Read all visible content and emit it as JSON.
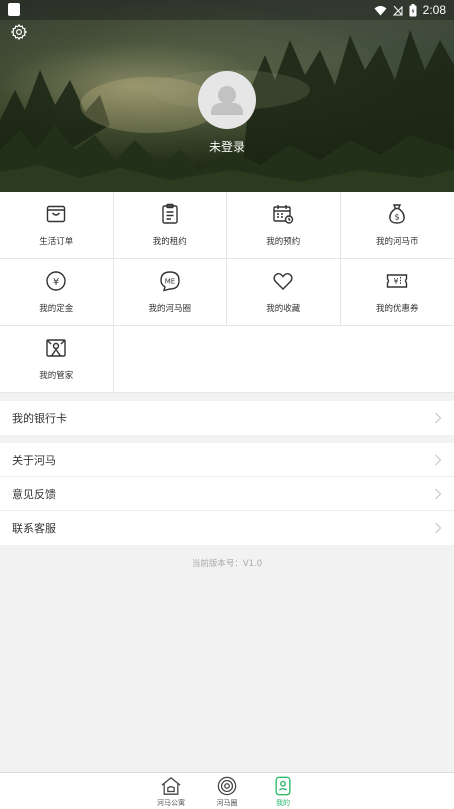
{
  "status_bar": {
    "time": "2:08"
  },
  "profile": {
    "login_text": "未登录"
  },
  "grid": [
    [
      {
        "label": "生活订单",
        "icon": "bag-icon"
      },
      {
        "label": "我的租约",
        "icon": "clipboard-icon"
      },
      {
        "label": "我的预约",
        "icon": "calendar-clock-icon"
      },
      {
        "label": "我的河马币",
        "icon": "money-bag-icon"
      }
    ],
    [
      {
        "label": "我的定金",
        "icon": "yen-coin-icon"
      },
      {
        "label": "我的河马圈",
        "icon": "me-chat-icon"
      },
      {
        "label": "我的收藏",
        "icon": "heart-icon"
      },
      {
        "label": "我的优惠券",
        "icon": "coupon-icon"
      }
    ],
    [
      {
        "label": "我的管家",
        "icon": "housekeeper-icon"
      }
    ]
  ],
  "bank_card": {
    "label": "我的银行卡"
  },
  "menu": [
    {
      "label": "关于河马"
    },
    {
      "label": "意见反馈"
    },
    {
      "label": "联系客服"
    }
  ],
  "version_text": "当前版本号：V1.0",
  "tabs": [
    {
      "label": "河马公寓",
      "icon": "house-icon",
      "active": false
    },
    {
      "label": "河马圈",
      "icon": "target-circle-icon",
      "active": false
    },
    {
      "label": "我的",
      "icon": "user-badge-icon",
      "active": true
    }
  ],
  "colors": {
    "accent": "#2eb86b",
    "icon_stroke": "#333333"
  }
}
